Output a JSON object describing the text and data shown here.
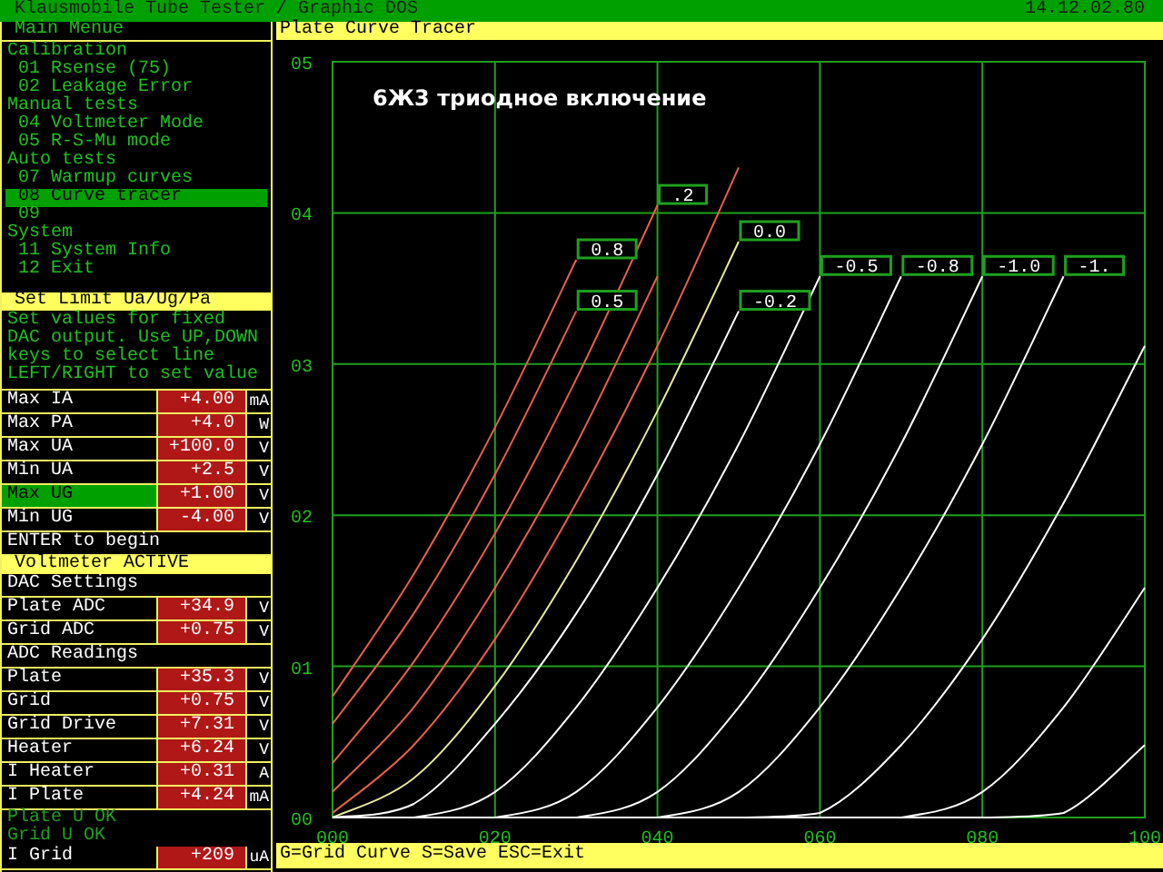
{
  "title_bar": {
    "title": "Klausmobile Tube Tester / Graphic DOS",
    "date": "14.12.02.80"
  },
  "main_menu": {
    "title": "Main Menue",
    "items": [
      {
        "kind": "section",
        "label": "Calibration",
        "selected": false
      },
      {
        "kind": "item",
        "label": "01 Rsense (75)",
        "selected": false
      },
      {
        "kind": "item",
        "label": "02 Leakage Error",
        "selected": false
      },
      {
        "kind": "section",
        "label": "Manual tests",
        "selected": false
      },
      {
        "kind": "item",
        "label": "04 Voltmeter Mode",
        "selected": false
      },
      {
        "kind": "item",
        "label": "05 R-S-Mu mode",
        "selected": false
      },
      {
        "kind": "section",
        "label": "Auto tests",
        "selected": false
      },
      {
        "kind": "item",
        "label": "07 Warmup curves",
        "selected": false
      },
      {
        "kind": "item",
        "label": "08 Curve tracer",
        "selected": true
      },
      {
        "kind": "item",
        "label": "09",
        "selected": false
      },
      {
        "kind": "section",
        "label": "System",
        "selected": false
      },
      {
        "kind": "item",
        "label": "11 System Info",
        "selected": false
      },
      {
        "kind": "item",
        "label": "12 Exit",
        "selected": false
      }
    ]
  },
  "limits": {
    "title": "Set Limit Ua/Ug/Pa",
    "help": "Set values for fixed DAC output. Use UP,DOWN keys to select line LEFT/RIGHT to set value",
    "rows": [
      {
        "label": "Max IA",
        "value": "+4.00",
        "unit": "mA",
        "selected": false
      },
      {
        "label": "Max PA",
        "value": "+4.0",
        "unit": "W",
        "selected": false
      },
      {
        "label": "Max UA",
        "value": "+100.0",
        "unit": "V",
        "selected": false
      },
      {
        "label": "Min UA",
        "value": "+2.5",
        "unit": "V",
        "selected": false
      },
      {
        "label": "Max UG",
        "value": "+1.00",
        "unit": "V",
        "selected": true
      },
      {
        "label": "Min UG",
        "value": "-4.00",
        "unit": "V",
        "selected": false
      }
    ],
    "prompt": "ENTER to begin"
  },
  "voltmeter": {
    "title": "Voltmeter ACTIVE",
    "groups": [
      {
        "title": "DAC Settings",
        "rows": [
          {
            "label": "Plate ADC",
            "value": "+34.9",
            "unit": "V"
          },
          {
            "label": "Grid ADC",
            "value": "+0.75",
            "unit": "V"
          }
        ]
      },
      {
        "title": "ADC Readings",
        "rows": [
          {
            "label": "Plate",
            "value": "+35.3",
            "unit": "V"
          },
          {
            "label": "Grid",
            "value": "+0.75",
            "unit": "V"
          },
          {
            "label": "Grid Drive",
            "value": "+7.31",
            "unit": "V"
          },
          {
            "label": "Heater",
            "value": "+6.24",
            "unit": "V"
          },
          {
            "label": "I Heater",
            "value": "+0.31",
            "unit": "A"
          },
          {
            "label": "I Plate",
            "value": "+4.24",
            "unit": "mA"
          }
        ]
      }
    ],
    "status": [
      "Plate U OK",
      "Grid U OK"
    ],
    "extra_rows": [
      {
        "label": "I Grid",
        "value": "+209",
        "unit": "uA"
      }
    ]
  },
  "plot": {
    "title": "Plate Curve Tracer",
    "hint": "G=Grid Curve S=Save ESC=Exit",
    "chart_data": {
      "type": "line",
      "title": "6Ж3 триодное включение",
      "x": [
        0,
        10,
        20,
        30,
        40,
        50,
        60,
        70,
        80,
        90,
        100
      ],
      "xlim": [
        0,
        100
      ],
      "ylim": [
        0,
        5
      ],
      "xticks": [
        {
          "value": 0,
          "label": "000"
        },
        {
          "value": 20,
          "label": "020"
        },
        {
          "value": 40,
          "label": "040"
        },
        {
          "value": 60,
          "label": "060"
        },
        {
          "value": 80,
          "label": "080"
        },
        {
          "value": 100,
          "label": "100"
        }
      ],
      "yticks": [
        {
          "value": 0,
          "label": "00"
        },
        {
          "value": 1,
          "label": "01"
        },
        {
          "value": 2,
          "label": "02"
        },
        {
          "value": 3,
          "label": "03"
        },
        {
          "value": 4,
          "label": "04"
        },
        {
          "value": 5,
          "label": "05"
        }
      ],
      "grid": true,
      "series": [
        {
          "name": "0.8",
          "color": "#e8604c",
          "values": [
            0.8,
            1.61,
            2.58,
            3.69,
            null,
            null,
            null,
            null,
            null,
            null,
            null
          ]
        },
        {
          "name": "0.5",
          "color": "#e8604c",
          "values": [
            0.62,
            1.35,
            2.27,
            3.35,
            null,
            null,
            null,
            null,
            null,
            null,
            null
          ]
        },
        {
          "name": ".2",
          "color": "#e8604c",
          "values": [
            0.36,
            1.03,
            1.88,
            2.9,
            4.05,
            null,
            null,
            null,
            null,
            null,
            null
          ]
        },
        {
          "color": "#e8604c",
          "values": [
            0.17,
            0.73,
            1.52,
            2.47,
            3.58,
            null,
            null,
            null,
            null,
            null,
            null
          ]
        },
        {
          "color": "#e8604c",
          "values": [
            0.03,
            0.48,
            1.18,
            2.08,
            3.12,
            4.3,
            null,
            null,
            null,
            null,
            null
          ]
        },
        {
          "name": "0.0",
          "color": "#e8e89a",
          "values": [
            0,
            0.26,
            0.87,
            1.7,
            2.69,
            3.81,
            null,
            null,
            null,
            null,
            null
          ]
        },
        {
          "name": "-0.2",
          "color": "#ffffff",
          "values": [
            0,
            0.09,
            0.62,
            1.35,
            2.27,
            3.35,
            null,
            null,
            null,
            null,
            null
          ]
        },
        {
          "name": "-0.5",
          "color": "#ffffff",
          "values": [
            0,
            0,
            0.17,
            0.73,
            1.52,
            2.47,
            3.58,
            null,
            null,
            null,
            null
          ]
        },
        {
          "name": "-0.8",
          "color": "#ffffff",
          "values": [
            0,
            0,
            0,
            0.17,
            0.73,
            1.52,
            2.47,
            3.58,
            null,
            null,
            null
          ]
        },
        {
          "name": "-1.0",
          "color": "#ffffff",
          "values": [
            0,
            0,
            0,
            0,
            0.17,
            0.73,
            1.52,
            2.47,
            3.58,
            null,
            null
          ]
        },
        {
          "name": "-1.",
          "color": "#ffffff",
          "values": [
            0,
            0,
            0,
            0,
            0,
            0.17,
            0.73,
            1.52,
            2.47,
            3.58,
            null
          ]
        },
        {
          "color": "#ffffff",
          "values": [
            0,
            0,
            0,
            0,
            0,
            0,
            0.03,
            0.48,
            1.18,
            2.08,
            3.12
          ]
        },
        {
          "color": "#ffffff",
          "values": [
            0,
            0,
            0,
            0,
            0,
            0,
            0,
            0,
            0.17,
            0.73,
            1.52
          ]
        },
        {
          "color": "#ffffff",
          "values": [
            0,
            0,
            0,
            0,
            0,
            0,
            0,
            0,
            0,
            0.03,
            0.48
          ]
        }
      ]
    }
  }
}
